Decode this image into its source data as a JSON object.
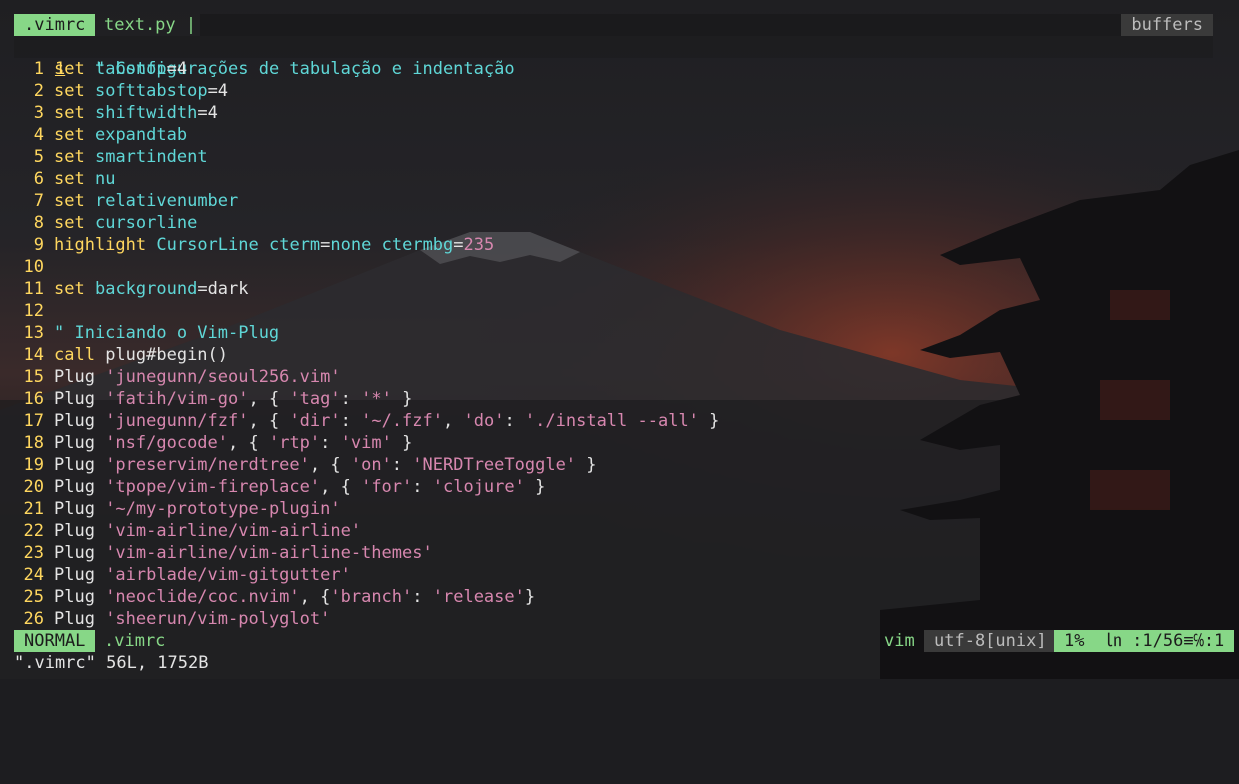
{
  "tabline": {
    "active_tab": ".vimrc",
    "inactive_tab": "text.py |",
    "buffers_label": "buffers"
  },
  "editor": {
    "current_line": {
      "number": "1",
      "text": "\" Configurações de tabulação e indentação"
    },
    "lines": [
      {
        "n": "1",
        "segs": [
          {
            "t": "set",
            "c": "kw"
          },
          {
            "t": " "
          },
          {
            "t": "tabstop",
            "c": "op"
          },
          {
            "t": "=4",
            "c": "plain"
          }
        ]
      },
      {
        "n": "2",
        "segs": [
          {
            "t": "set",
            "c": "kw"
          },
          {
            "t": " "
          },
          {
            "t": "softtabstop",
            "c": "op"
          },
          {
            "t": "=4",
            "c": "plain"
          }
        ]
      },
      {
        "n": "3",
        "segs": [
          {
            "t": "set",
            "c": "kw"
          },
          {
            "t": " "
          },
          {
            "t": "shiftwidth",
            "c": "op"
          },
          {
            "t": "=4",
            "c": "plain"
          }
        ]
      },
      {
        "n": "4",
        "segs": [
          {
            "t": "set",
            "c": "kw"
          },
          {
            "t": " "
          },
          {
            "t": "expandtab",
            "c": "op"
          }
        ]
      },
      {
        "n": "5",
        "segs": [
          {
            "t": "set",
            "c": "kw"
          },
          {
            "t": " "
          },
          {
            "t": "smartindent",
            "c": "op"
          }
        ]
      },
      {
        "n": "6",
        "segs": [
          {
            "t": "set",
            "c": "kw"
          },
          {
            "t": " "
          },
          {
            "t": "nu",
            "c": "op"
          }
        ]
      },
      {
        "n": "7",
        "segs": [
          {
            "t": "set",
            "c": "kw"
          },
          {
            "t": " "
          },
          {
            "t": "relativenumber",
            "c": "op"
          }
        ]
      },
      {
        "n": "8",
        "segs": [
          {
            "t": "set",
            "c": "kw"
          },
          {
            "t": " "
          },
          {
            "t": "cursorline",
            "c": "op"
          }
        ]
      },
      {
        "n": "9",
        "segs": [
          {
            "t": "highlight",
            "c": "kw"
          },
          {
            "t": " "
          },
          {
            "t": "CursorLine",
            "c": "op"
          },
          {
            "t": " "
          },
          {
            "t": "cterm",
            "c": "op"
          },
          {
            "t": "=",
            "c": "plain"
          },
          {
            "t": "none",
            "c": "op"
          },
          {
            "t": " "
          },
          {
            "t": "ctermbg",
            "c": "op"
          },
          {
            "t": "=",
            "c": "plain"
          },
          {
            "t": "235",
            "c": "num"
          }
        ]
      },
      {
        "n": "10",
        "segs": []
      },
      {
        "n": "11",
        "segs": [
          {
            "t": "set",
            "c": "kw"
          },
          {
            "t": " "
          },
          {
            "t": "background",
            "c": "op"
          },
          {
            "t": "=dark",
            "c": "plain"
          }
        ]
      },
      {
        "n": "12",
        "segs": []
      },
      {
        "n": "13",
        "segs": [
          {
            "t": "\" Iniciando o Vim-Plug",
            "c": "cmt"
          }
        ]
      },
      {
        "n": "14",
        "segs": [
          {
            "t": "call",
            "c": "kw"
          },
          {
            "t": " plug#begin()",
            "c": "plain"
          }
        ]
      },
      {
        "n": "15",
        "segs": [
          {
            "t": "Plug ",
            "c": "plain"
          },
          {
            "t": "'junegunn/seoul256.vim'",
            "c": "str"
          }
        ]
      },
      {
        "n": "16",
        "segs": [
          {
            "t": "Plug ",
            "c": "plain"
          },
          {
            "t": "'fatih/vim-go'",
            "c": "str"
          },
          {
            "t": ", { ",
            "c": "plain"
          },
          {
            "t": "'tag'",
            "c": "str"
          },
          {
            "t": ": ",
            "c": "plain"
          },
          {
            "t": "'*'",
            "c": "str"
          },
          {
            "t": " }",
            "c": "plain"
          }
        ]
      },
      {
        "n": "17",
        "segs": [
          {
            "t": "Plug ",
            "c": "plain"
          },
          {
            "t": "'junegunn/fzf'",
            "c": "str"
          },
          {
            "t": ", { ",
            "c": "plain"
          },
          {
            "t": "'dir'",
            "c": "str"
          },
          {
            "t": ": ",
            "c": "plain"
          },
          {
            "t": "'~/.fzf'",
            "c": "str"
          },
          {
            "t": ", ",
            "c": "plain"
          },
          {
            "t": "'do'",
            "c": "str"
          },
          {
            "t": ": ",
            "c": "plain"
          },
          {
            "t": "'./install --all'",
            "c": "str"
          },
          {
            "t": " }",
            "c": "plain"
          }
        ]
      },
      {
        "n": "18",
        "segs": [
          {
            "t": "Plug ",
            "c": "plain"
          },
          {
            "t": "'nsf/gocode'",
            "c": "str"
          },
          {
            "t": ", { ",
            "c": "plain"
          },
          {
            "t": "'rtp'",
            "c": "str"
          },
          {
            "t": ": ",
            "c": "plain"
          },
          {
            "t": "'vim'",
            "c": "str"
          },
          {
            "t": " }",
            "c": "plain"
          }
        ]
      },
      {
        "n": "19",
        "segs": [
          {
            "t": "Plug ",
            "c": "plain"
          },
          {
            "t": "'preservim/nerdtree'",
            "c": "str"
          },
          {
            "t": ", { ",
            "c": "plain"
          },
          {
            "t": "'on'",
            "c": "str"
          },
          {
            "t": ": ",
            "c": "plain"
          },
          {
            "t": "'NERDTreeToggle'",
            "c": "str"
          },
          {
            "t": " }",
            "c": "plain"
          }
        ]
      },
      {
        "n": "20",
        "segs": [
          {
            "t": "Plug ",
            "c": "plain"
          },
          {
            "t": "'tpope/vim-fireplace'",
            "c": "str"
          },
          {
            "t": ", { ",
            "c": "plain"
          },
          {
            "t": "'for'",
            "c": "str"
          },
          {
            "t": ": ",
            "c": "plain"
          },
          {
            "t": "'clojure'",
            "c": "str"
          },
          {
            "t": " }",
            "c": "plain"
          }
        ]
      },
      {
        "n": "21",
        "segs": [
          {
            "t": "Plug ",
            "c": "plain"
          },
          {
            "t": "'~/my-prototype-plugin'",
            "c": "str"
          }
        ]
      },
      {
        "n": "22",
        "segs": [
          {
            "t": "Plug ",
            "c": "plain"
          },
          {
            "t": "'vim-airline/vim-airline'",
            "c": "str"
          }
        ]
      },
      {
        "n": "23",
        "segs": [
          {
            "t": "Plug ",
            "c": "plain"
          },
          {
            "t": "'vim-airline/vim-airline-themes'",
            "c": "str"
          }
        ]
      },
      {
        "n": "24",
        "segs": [
          {
            "t": "Plug ",
            "c": "plain"
          },
          {
            "t": "'airblade/vim-gitgutter'",
            "c": "str"
          }
        ]
      },
      {
        "n": "25",
        "segs": [
          {
            "t": "Plug ",
            "c": "plain"
          },
          {
            "t": "'neoclide/coc.nvim'",
            "c": "str"
          },
          {
            "t": ", {",
            "c": "plain"
          },
          {
            "t": "'branch'",
            "c": "str"
          },
          {
            "t": ": ",
            "c": "plain"
          },
          {
            "t": "'release'",
            "c": "str"
          },
          {
            "t": "}",
            "c": "plain"
          }
        ]
      },
      {
        "n": "26",
        "segs": [
          {
            "t": "Plug ",
            "c": "plain"
          },
          {
            "t": "'sheerun/vim-polyglot'",
            "c": "str"
          }
        ]
      }
    ]
  },
  "statusline": {
    "mode": "NORMAL",
    "filename": ".vimrc",
    "filetype": "vim",
    "encoding": "utf-8[unix]",
    "position": "1%  ㏑ :1/56≡℅:1"
  },
  "message": "\".vimrc\" 56L, 1752B",
  "colors": {
    "accent_green": "#87d787",
    "line_number": "#ffd75f",
    "identifier": "#5fd7d7",
    "string": "#d787af"
  }
}
